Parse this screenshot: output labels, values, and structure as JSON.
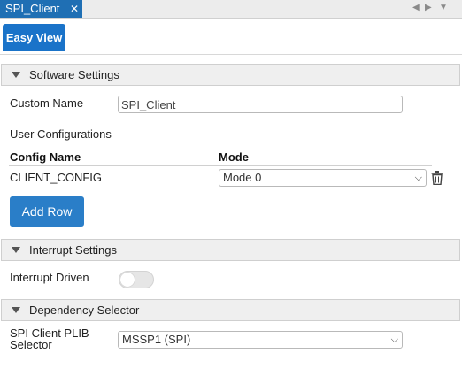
{
  "tab": {
    "title": "SPI_Client",
    "close": "✕"
  },
  "controls": {
    "prev": "◀",
    "next": "▶",
    "menu": "▼"
  },
  "subtab": {
    "label": "Easy View"
  },
  "software": {
    "title": "Software Settings",
    "custom_name_label": "Custom Name",
    "custom_name_value": "SPI_Client",
    "user_config_label": "User Configurations",
    "col_config": "Config Name",
    "col_mode": "Mode",
    "rows": [
      {
        "name": "CLIENT_CONFIG",
        "mode": "Mode 0"
      }
    ],
    "add_row": "Add Row"
  },
  "interrupt": {
    "title": "Interrupt Settings",
    "driven_label": "Interrupt Driven",
    "driven_on": false
  },
  "dependency": {
    "title": "Dependency Selector",
    "plib_label_1": "SPI Client PLIB",
    "plib_label_2": "Selector",
    "plib_value": "MSSP1 (SPI)"
  },
  "colors": {
    "tab": "#1f6fb4",
    "accent": "#1a73c9",
    "button": "#2a7ec8"
  },
  "icons": {
    "expand": "triangle-down-icon",
    "delete": "trash-icon",
    "dropdown": "chevron-down-icon"
  }
}
